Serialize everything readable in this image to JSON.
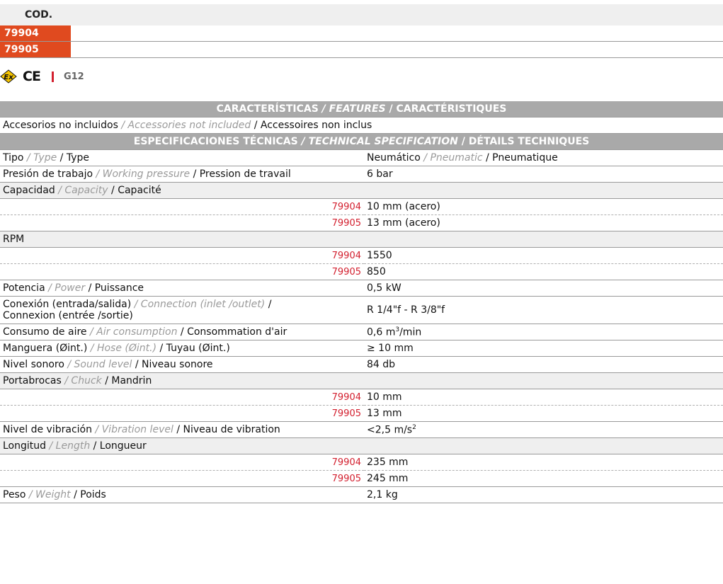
{
  "codes": {
    "header": "COD.",
    "items": [
      "79904",
      "79905"
    ]
  },
  "certifications": {
    "ex_icon": "atex-ex-icon",
    "ce": "CE",
    "group": "G12"
  },
  "colors": {
    "code_accent": "#e04a1f",
    "header_bg": "#a9a9a9",
    "model_red": "#d3202f",
    "italic_gray": "#9a9a9a"
  },
  "features": {
    "header": {
      "es": "CARACTERÍSTICAS",
      "en": "/ FEATURES",
      "fr": "/ CARACTÉRISTIQUES"
    },
    "row": {
      "es": "Accesorios no incluidos",
      "en": "/ Accessories not included",
      "fr": "/ Accessoires non inclus"
    }
  },
  "specs_header": {
    "es": "ESPECIFICACIONES TÉCNICAS",
    "en": "/ TECHNICAL SPECIFICATION",
    "fr": "/ DÉTAILS TECHNIQUES"
  },
  "specs": {
    "tipo": {
      "es": "Tipo",
      "en": "/ Type",
      "fr": "/ Type",
      "v_es": "Neumático",
      "v_en": "/ Pneumatic",
      "v_fr": "/ Pneumatique"
    },
    "presion": {
      "es": "Presión de trabajo",
      "en": "/ Working pressure",
      "fr": "/ Pression de travail",
      "value": "6 bar"
    },
    "capacidad": {
      "es": "Capacidad",
      "en": "/ Capacity",
      "fr": "/ Capacité",
      "rows": [
        {
          "code": "79904",
          "value": "10 mm (acero)"
        },
        {
          "code": "79905",
          "value": "13 mm (acero)"
        }
      ]
    },
    "rpm": {
      "label": "RPM",
      "rows": [
        {
          "code": "79904",
          "value": "1550"
        },
        {
          "code": "79905",
          "value": "850"
        }
      ]
    },
    "potencia": {
      "es": "Potencia",
      "en": "/ Power",
      "fr": "/ Puissance",
      "value": "0,5 kW"
    },
    "conexion": {
      "es": "Conexión (entrada/salida)",
      "en": "/ Connection (inlet /outlet)",
      "fr_a": "/",
      "fr_b": "Connexion (entrée /sortie)",
      "value": "R 1/4\"f - R 3/8\"f"
    },
    "consumo": {
      "es": "Consumo de aire",
      "en": "/ Air consumption",
      "fr": "/ Consommation d'air",
      "value": "0,6 m",
      "value_sup": "3",
      "value_end": "/min"
    },
    "manguera": {
      "es": "Manguera (Øint.)",
      "en": "/ Hose (Øint.)",
      "fr": "/ Tuyau (Øint.)",
      "value": "≥ 10 mm"
    },
    "nivel_sonoro": {
      "es": "Nivel sonoro",
      "en": "/ Sound level",
      "fr": "/ Niveau sonore",
      "value": "84 db"
    },
    "portabrocas": {
      "es": "Portabrocas",
      "en": "/ Chuck",
      "fr": "/ Mandrin",
      "rows": [
        {
          "code": "79904",
          "value": "10 mm"
        },
        {
          "code": "79905",
          "value": "13 mm"
        }
      ]
    },
    "vibracion": {
      "es": "Nivel de vibración",
      "en": "/ Vibration level",
      "fr": "/ Niveau de vibration",
      "value": "<2,5 m/s",
      "value_sup": "2"
    },
    "longitud": {
      "es": "Longitud",
      "en": "/ Length",
      "fr": "/ Longueur",
      "rows": [
        {
          "code": "79904",
          "value": "235 mm"
        },
        {
          "code": "79905",
          "value": "245 mm"
        }
      ]
    },
    "peso": {
      "es": "Peso",
      "en": "/ Weight",
      "fr": "/ Poids",
      "value": "2,1 kg"
    }
  }
}
